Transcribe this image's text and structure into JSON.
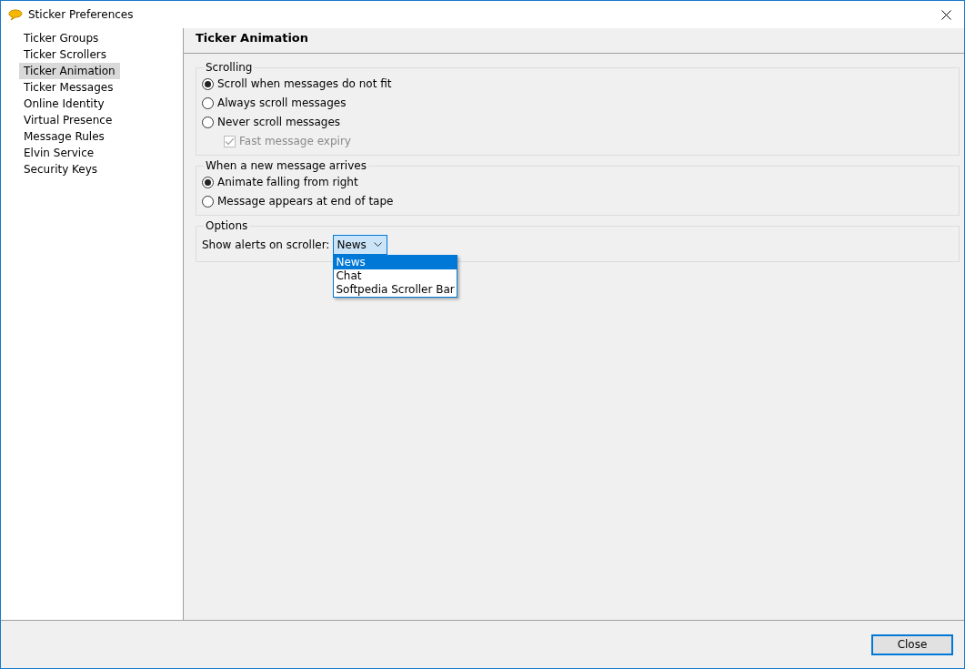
{
  "window": {
    "title": "Sticker Preferences"
  },
  "sidebar": {
    "items": [
      {
        "label": "Ticker Groups",
        "selected": false
      },
      {
        "label": "Ticker Scrollers",
        "selected": false
      },
      {
        "label": "Ticker Animation",
        "selected": true
      },
      {
        "label": "Ticker Messages",
        "selected": false
      },
      {
        "label": "Online Identity",
        "selected": false
      },
      {
        "label": "Virtual Presence",
        "selected": false
      },
      {
        "label": "Message Rules",
        "selected": false
      },
      {
        "label": "Elvin Service",
        "selected": false
      },
      {
        "label": "Security Keys",
        "selected": false
      }
    ]
  },
  "panel": {
    "title": "Ticker Animation",
    "groups": [
      {
        "title": "Scrolling",
        "kind": "options",
        "options": [
          {
            "kind": "radio",
            "label": "Scroll when messages do not fit",
            "selected": true
          },
          {
            "kind": "radio",
            "label": "Always scroll messages",
            "selected": false
          },
          {
            "kind": "radio",
            "label": "Never scroll messages",
            "selected": false
          },
          {
            "kind": "checkbox",
            "label": "Fast message expiry",
            "checked": true,
            "disabled": true
          }
        ]
      },
      {
        "title": "When a new message arrives",
        "kind": "options",
        "options": [
          {
            "kind": "radio",
            "label": "Animate falling from right",
            "selected": true
          },
          {
            "kind": "radio",
            "label": "Message appears at end of tape",
            "selected": false
          }
        ]
      },
      {
        "title": "Options",
        "kind": "select",
        "label": "Show alerts on scroller:",
        "value": "News",
        "expanded": true,
        "options": [
          {
            "label": "News",
            "selected": true
          },
          {
            "label": "Chat",
            "selected": false
          },
          {
            "label": "Softpedia Scroller Bar",
            "selected": false
          }
        ]
      }
    ]
  },
  "footer": {
    "buttons": [
      "Close"
    ]
  }
}
